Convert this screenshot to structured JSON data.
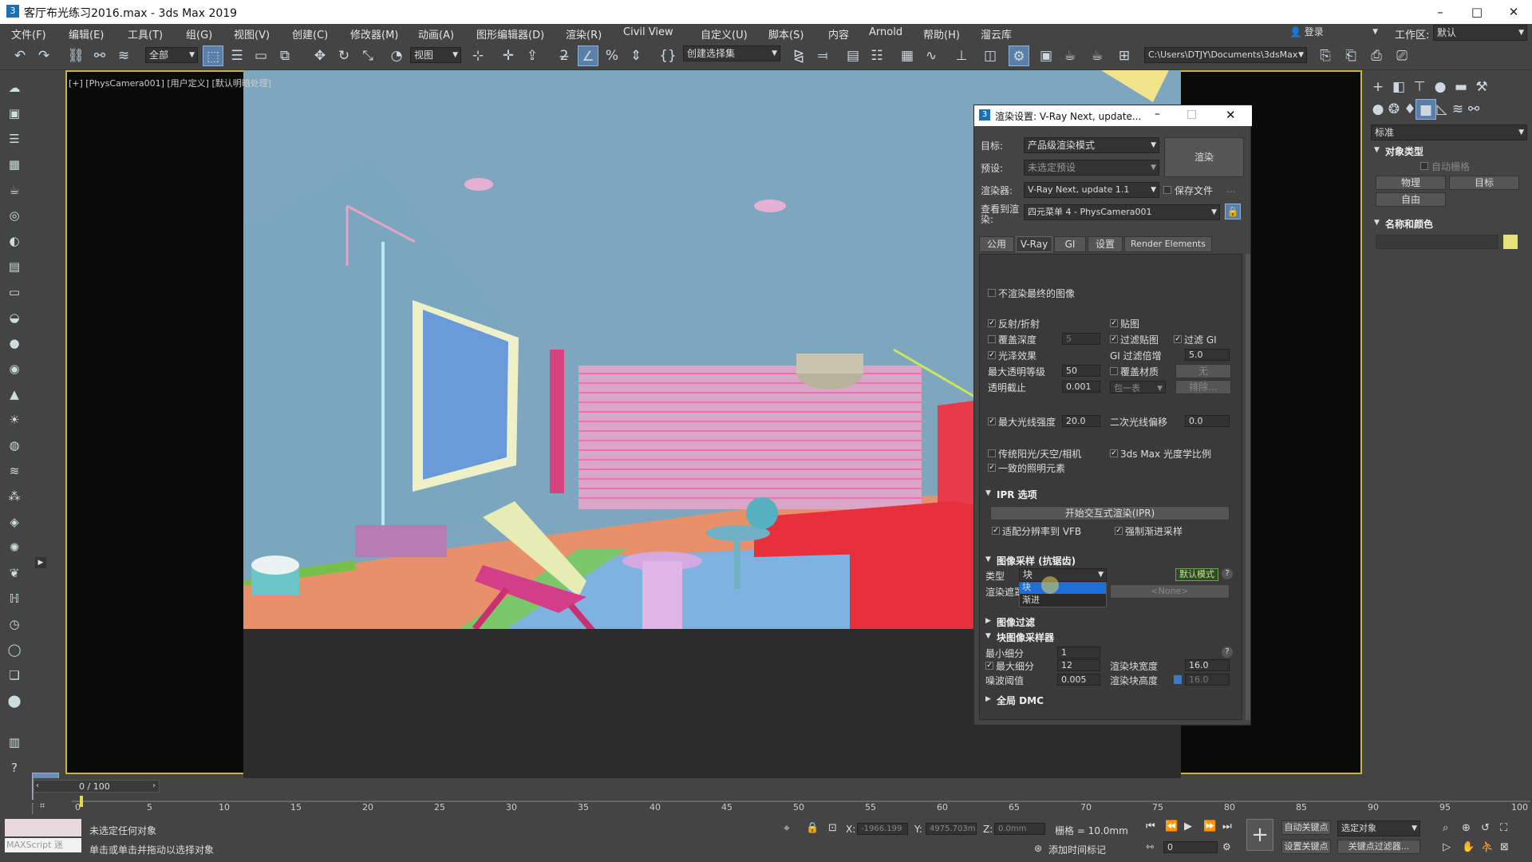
{
  "window": {
    "title": "客厅布光练习2016.max - 3ds Max 2019",
    "minimize": "–",
    "maximize": "□",
    "close": "✕"
  },
  "menu": [
    "文件(F)",
    "编辑(E)",
    "工具(T)",
    "组(G)",
    "视图(V)",
    "创建(C)",
    "修改器(M)",
    "动画(A)",
    "图形编辑器(D)",
    "渲染(R)",
    "Civil View",
    "自定义(U)",
    "脚本(S)",
    "内容",
    "Arnold",
    "帮助(H)",
    "溜云库"
  ],
  "account": {
    "login": "登录",
    "workspace_label": "工作区:",
    "workspace_value": "默认"
  },
  "toolbar": {
    "filter": "全部",
    "view": "视图",
    "selection_set": "创建选择集",
    "path": "C:\\Users\\DTJY\\Documents\\3dsMax"
  },
  "viewport": {
    "label": "[+] [PhysCamera001] [用户定义] [默认明暗处理]"
  },
  "colors": {
    "accent": "#c8b54a",
    "selected": "#1e6fd9",
    "scene_wall": "#7fa6bf",
    "floor": "#e8906a"
  },
  "dialog": {
    "title": "渲染设置: V-Ray Next, update...",
    "target_label": "目标:",
    "target_value": "产品级渲染模式",
    "preset_label": "预设:",
    "preset_value": "未选定预设",
    "renderer_label": "渲染器:",
    "renderer_value": "V-Ray Next, update 1.1",
    "save_file": "保存文件",
    "more": "...",
    "view_label": "查看到渲染:",
    "view_value": "四元菜单 4 - PhysCamera001",
    "render_button": "渲染",
    "tabs": [
      "公用",
      "V-Ray",
      "GI",
      "设置",
      "Render Elements"
    ],
    "dont_render_final": "不渲染最终的图像",
    "reflection": "反射/折射",
    "maps": "贴图",
    "override_depth": "覆盖深度",
    "override_depth_val": "5",
    "filter_maps": "过滤贴图",
    "filter_gi": "过滤 GI",
    "glossy": "光泽效果",
    "gi_filter_mult": "GI 过滤倍增",
    "gi_filter_mult_val": "5.0",
    "max_transp": "最大透明等级",
    "max_transp_val": "50",
    "override_mtl": "覆盖材质",
    "none": "无",
    "transp_cutoff": "透明截止",
    "transp_cutoff_val": "0.001",
    "include_list": "包一表",
    "exclude": "排除...",
    "max_ray": "最大光线强度",
    "max_ray_val": "20.0",
    "secondary_bias": "二次光线偏移",
    "secondary_bias_val": "0.0",
    "legacy_sun": "传统阳光/天空/相机",
    "max_photometric": "3ds Max 光度学比例",
    "consistent_light": "一致的照明元素",
    "ipr_header": "IPR 选项",
    "ipr_button": "开始交互式渲染(IPR)",
    "fit_vfb": "适配分辨率到 VFB",
    "force_prog": "强制渐进采样",
    "image_sampler_header": "图像采样 (抗锯齿)",
    "type_label": "类型",
    "type_value": "块",
    "default_mode": "默认模式",
    "render_mask": "渲染遮罩",
    "render_mask_val": "<None>",
    "dropdown_items": [
      "块",
      "渐进"
    ],
    "image_filter_header": "图像过滤",
    "bucket_header": "块图像采样器",
    "min_subdiv": "最小细分",
    "min_subdiv_val": "1",
    "max_subdiv": "最大细分",
    "max_subdiv_val": "12",
    "bucket_w": "渲染块宽度",
    "bucket_w_val": "16.0",
    "noise": "噪波阈值",
    "noise_val": "0.005",
    "bucket_h": "渲染块高度",
    "bucket_h_val": "16.0",
    "global_dmc": "全局 DMC"
  },
  "cmdpanel": {
    "dropdown": "标准",
    "object_type": "对象类型",
    "autogrid": "自动栅格",
    "physical": "物理",
    "target": "目标",
    "free": "自由",
    "name_color": "名称和颜色"
  },
  "timeline": {
    "frame": "0 / 100",
    "ticks": [
      "0",
      "5",
      "10",
      "15",
      "20",
      "25",
      "30",
      "35",
      "40",
      "45",
      "50",
      "55",
      "60",
      "65",
      "70",
      "75",
      "80",
      "85",
      "90",
      "95",
      "100"
    ]
  },
  "status": {
    "maxscript": "MAXScript 迷",
    "line1": "未选定任何对象",
    "line2": "单击或单击并拖动以选择对象",
    "x_label": "X:",
    "x_val": "-1966.199",
    "y_label": "Y:",
    "y_val": "4975.703m",
    "z_label": "Z:",
    "z_val": "0.0mm",
    "grid": "栅格 = 10.0mm",
    "add_time_tag": "添加时间标记",
    "auto_key": "自动关键点",
    "set_key": "设置关键点",
    "selected": "选定对象",
    "key_filters": "关键点过滤器...",
    "frame_val": "0"
  }
}
